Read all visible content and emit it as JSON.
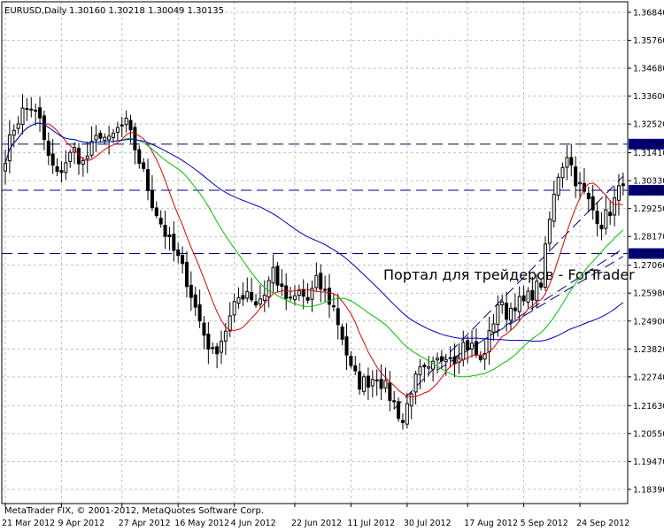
{
  "header": {
    "symbol": "EURUSD,Daily",
    "ohlc": "1.30160 1.30218 1.30049 1.30135"
  },
  "copyright": "MetaTrader FIX, © 2001-2012, MetaQuotes Software Corp.",
  "watermark": "Портал для трейдеров - ForTrader",
  "colors": {
    "background": "#ffffff",
    "grid": "#c0c0c0",
    "candles": "#000000",
    "ma_red": "#e00000",
    "ma_green": "#00c000",
    "ma_blue": "#0000c0",
    "hline": "#000080",
    "price_tag_bg": "#000080",
    "price_tag_text": "#ffffff",
    "watermark": "#9a9a9a"
  },
  "chart_data": {
    "type": "candlestick",
    "ylim": [
      1.1784,
      1.3725
    ],
    "y_ticks": [
      "1.36840",
      "1.35760",
      "1.34680",
      "1.33600",
      "1.32520",
      "1.31410",
      "1.30330",
      "1.29250",
      "1.28170",
      "1.27060",
      "1.25980",
      "1.24900",
      "1.23820",
      "1.22740",
      "1.21630",
      "1.20550",
      "1.19470",
      "1.18390"
    ],
    "x_labels": [
      {
        "label": "21 Mar 2012",
        "index": 0
      },
      {
        "label": "9 Apr 2012",
        "index": 13
      },
      {
        "label": "27 Apr 2012",
        "index": 27
      },
      {
        "label": "16 May 2012",
        "index": 40
      },
      {
        "label": "4 Jun 2012",
        "index": 53
      },
      {
        "label": "22 Jun 2012",
        "index": 67
      },
      {
        "label": "11 Jul 2012",
        "index": 80
      },
      {
        "label": "30 Jul 2012",
        "index": 93
      },
      {
        "label": "17 Aug 2012",
        "index": 107
      },
      {
        "label": "5 Sep 2012",
        "index": 120
      },
      {
        "label": "24 Sep 2012",
        "index": 133
      }
    ],
    "anchors": [
      [
        0,
        1.313
      ],
      [
        2,
        1.324
      ],
      [
        4,
        1.33
      ],
      [
        6,
        1.332
      ],
      [
        8,
        1.326
      ],
      [
        10,
        1.312
      ],
      [
        12,
        1.305
      ],
      [
        14,
        1.311
      ],
      [
        16,
        1.315
      ],
      [
        18,
        1.31
      ],
      [
        20,
        1.316
      ],
      [
        22,
        1.322
      ],
      [
        24,
        1.318
      ],
      [
        26,
        1.323
      ],
      [
        28,
        1.325
      ],
      [
        30,
        1.316
      ],
      [
        32,
        1.306
      ],
      [
        34,
        1.295
      ],
      [
        36,
        1.287
      ],
      [
        38,
        1.279
      ],
      [
        40,
        1.273
      ],
      [
        42,
        1.265
      ],
      [
        44,
        1.254
      ],
      [
        46,
        1.244
      ],
      [
        48,
        1.236
      ],
      [
        50,
        1.242
      ],
      [
        52,
        1.25
      ],
      [
        54,
        1.258
      ],
      [
        56,
        1.261
      ],
      [
        58,
        1.256
      ],
      [
        60,
        1.26
      ],
      [
        62,
        1.269
      ],
      [
        64,
        1.26
      ],
      [
        66,
        1.256
      ],
      [
        68,
        1.26
      ],
      [
        70,
        1.257
      ],
      [
        72,
        1.264
      ],
      [
        74,
        1.26
      ],
      [
        76,
        1.254
      ],
      [
        78,
        1.243
      ],
      [
        80,
        1.23
      ],
      [
        82,
        1.225
      ],
      [
        84,
        1.226
      ],
      [
        86,
        1.228
      ],
      [
        88,
        1.223
      ],
      [
        90,
        1.217
      ],
      [
        92,
        1.21
      ],
      [
        94,
        1.223
      ],
      [
        96,
        1.229
      ],
      [
        98,
        1.229
      ],
      [
        100,
        1.233
      ],
      [
        102,
        1.237
      ],
      [
        104,
        1.235
      ],
      [
        106,
        1.24
      ],
      [
        108,
        1.239
      ],
      [
        110,
        1.233
      ],
      [
        112,
        1.243
      ],
      [
        114,
        1.256
      ],
      [
        116,
        1.252
      ],
      [
        118,
        1.256
      ],
      [
        120,
        1.256
      ],
      [
        122,
        1.26
      ],
      [
        124,
        1.264
      ],
      [
        126,
        1.288
      ],
      [
        128,
        1.306
      ],
      [
        130,
        1.314
      ],
      [
        132,
        1.304
      ],
      [
        134,
        1.298
      ],
      [
        136,
        1.292
      ],
      [
        138,
        1.287
      ],
      [
        140,
        1.292
      ],
      [
        142,
        1.299
      ],
      [
        143,
        1.3014
      ]
    ],
    "moving_averages": [
      {
        "color": "ma_red",
        "period": 10
      },
      {
        "color": "ma_green",
        "period": 28
      },
      {
        "color": "ma_blue",
        "period": 60
      }
    ],
    "horizontal_lines": [
      {
        "value": 1.31744,
        "label": "1.31744"
      },
      {
        "value": 1.2996,
        "label": "1.29960"
      },
      {
        "value": 1.27511,
        "label": "1.27511"
      }
    ],
    "trend_lines": [
      [
        [
          90,
          1.215
        ],
        [
          143,
          1.305
        ]
      ],
      [
        [
          100,
          1.23
        ],
        [
          143,
          1.277
        ]
      ],
      [
        [
          104,
          1.235
        ],
        [
          143,
          1.274
        ]
      ]
    ]
  }
}
